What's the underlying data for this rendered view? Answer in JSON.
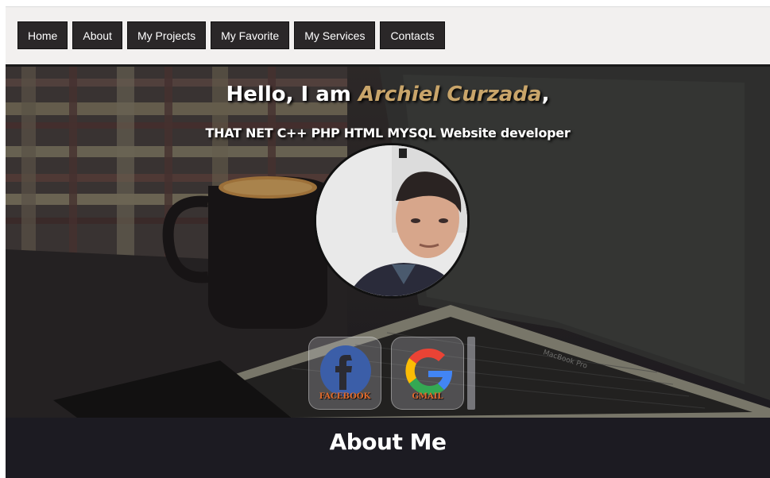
{
  "nav": {
    "items": [
      "Home",
      "About",
      "My Projects",
      "My Favorite",
      "My Services",
      "Contacts"
    ]
  },
  "hero": {
    "greeting": "Hello, I am ",
    "name": "Archiel Curzada",
    "comma": ",",
    "subtitle": "THAT NET C++ PHP HTML MYSQL Website developer",
    "laptop_brand": "MacBook Pro",
    "name_color": "#c9a56a"
  },
  "social": {
    "facebook_label": "FACEBOOK",
    "gmail_label": "GMAIL",
    "facebook_icon": "facebook-icon",
    "gmail_icon": "google-icon"
  },
  "about": {
    "title": "About Me"
  }
}
